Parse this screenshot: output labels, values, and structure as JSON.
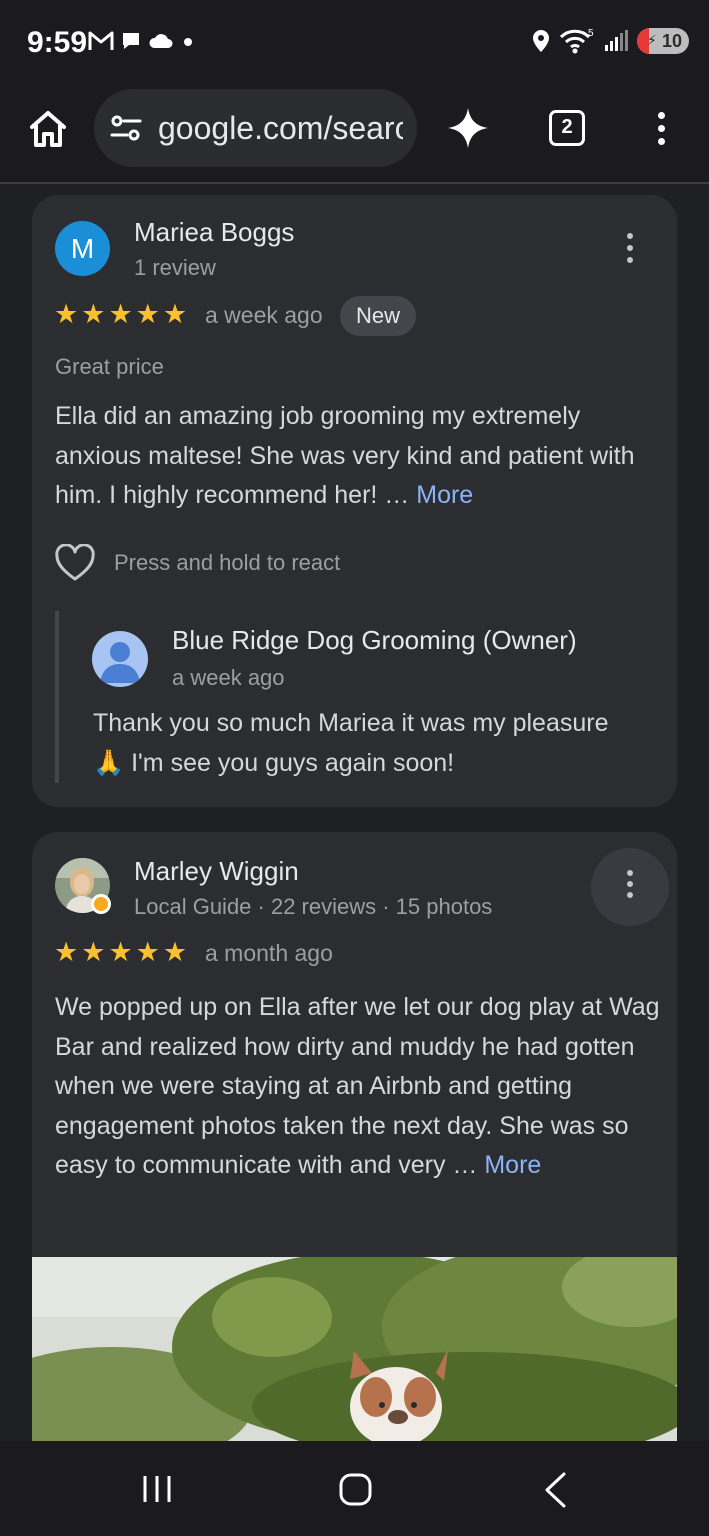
{
  "status_bar": {
    "time": "9:59",
    "left_icons": [
      "gmail-icon",
      "chat-bubble-icon",
      "cloud-icon",
      "dot-icon"
    ],
    "right_icons": [
      "location-icon",
      "wifi-icon",
      "signal-icon"
    ],
    "wifi_badge": "5",
    "battery_level": "10"
  },
  "toolbar": {
    "url": "google.com/search"
  },
  "tab_count": "2",
  "reviews": [
    {
      "avatar_letter": "M",
      "name": "Mariea Boggs",
      "meta": "1 review",
      "rating": 5,
      "time": "a week ago",
      "badge": "New",
      "quality": "Great price",
      "text": "Ella did an amazing job grooming my extremely anxious maltese! She was very kind and patient with him. I highly recommend her! …",
      "more_label": "More",
      "react_label": "Press and hold to react",
      "owner_reply": {
        "name": "Blue Ridge Dog Grooming (Owner)",
        "time": "a week ago",
        "text": "Thank you so much Mariea it was my pleasure 🙏 I'm see you guys again soon!"
      }
    },
    {
      "name": "Marley Wiggin",
      "meta": "Local Guide · 22 reviews · 15 photos",
      "rating": 5,
      "time": "a month ago",
      "text": "We popped up on Ella after we let our dog play at Wag Bar and realized how dirty and muddy he had gotten when we were staying at an Airbnb and getting engagement photos taken the next day. She was so easy to communicate with and very …",
      "more_label": "More"
    }
  ],
  "colors": {
    "accent_link": "#8ab4f8",
    "star": "#fbc02d",
    "card_bg": "#2c2d31",
    "page_bg": "#1f2024"
  }
}
